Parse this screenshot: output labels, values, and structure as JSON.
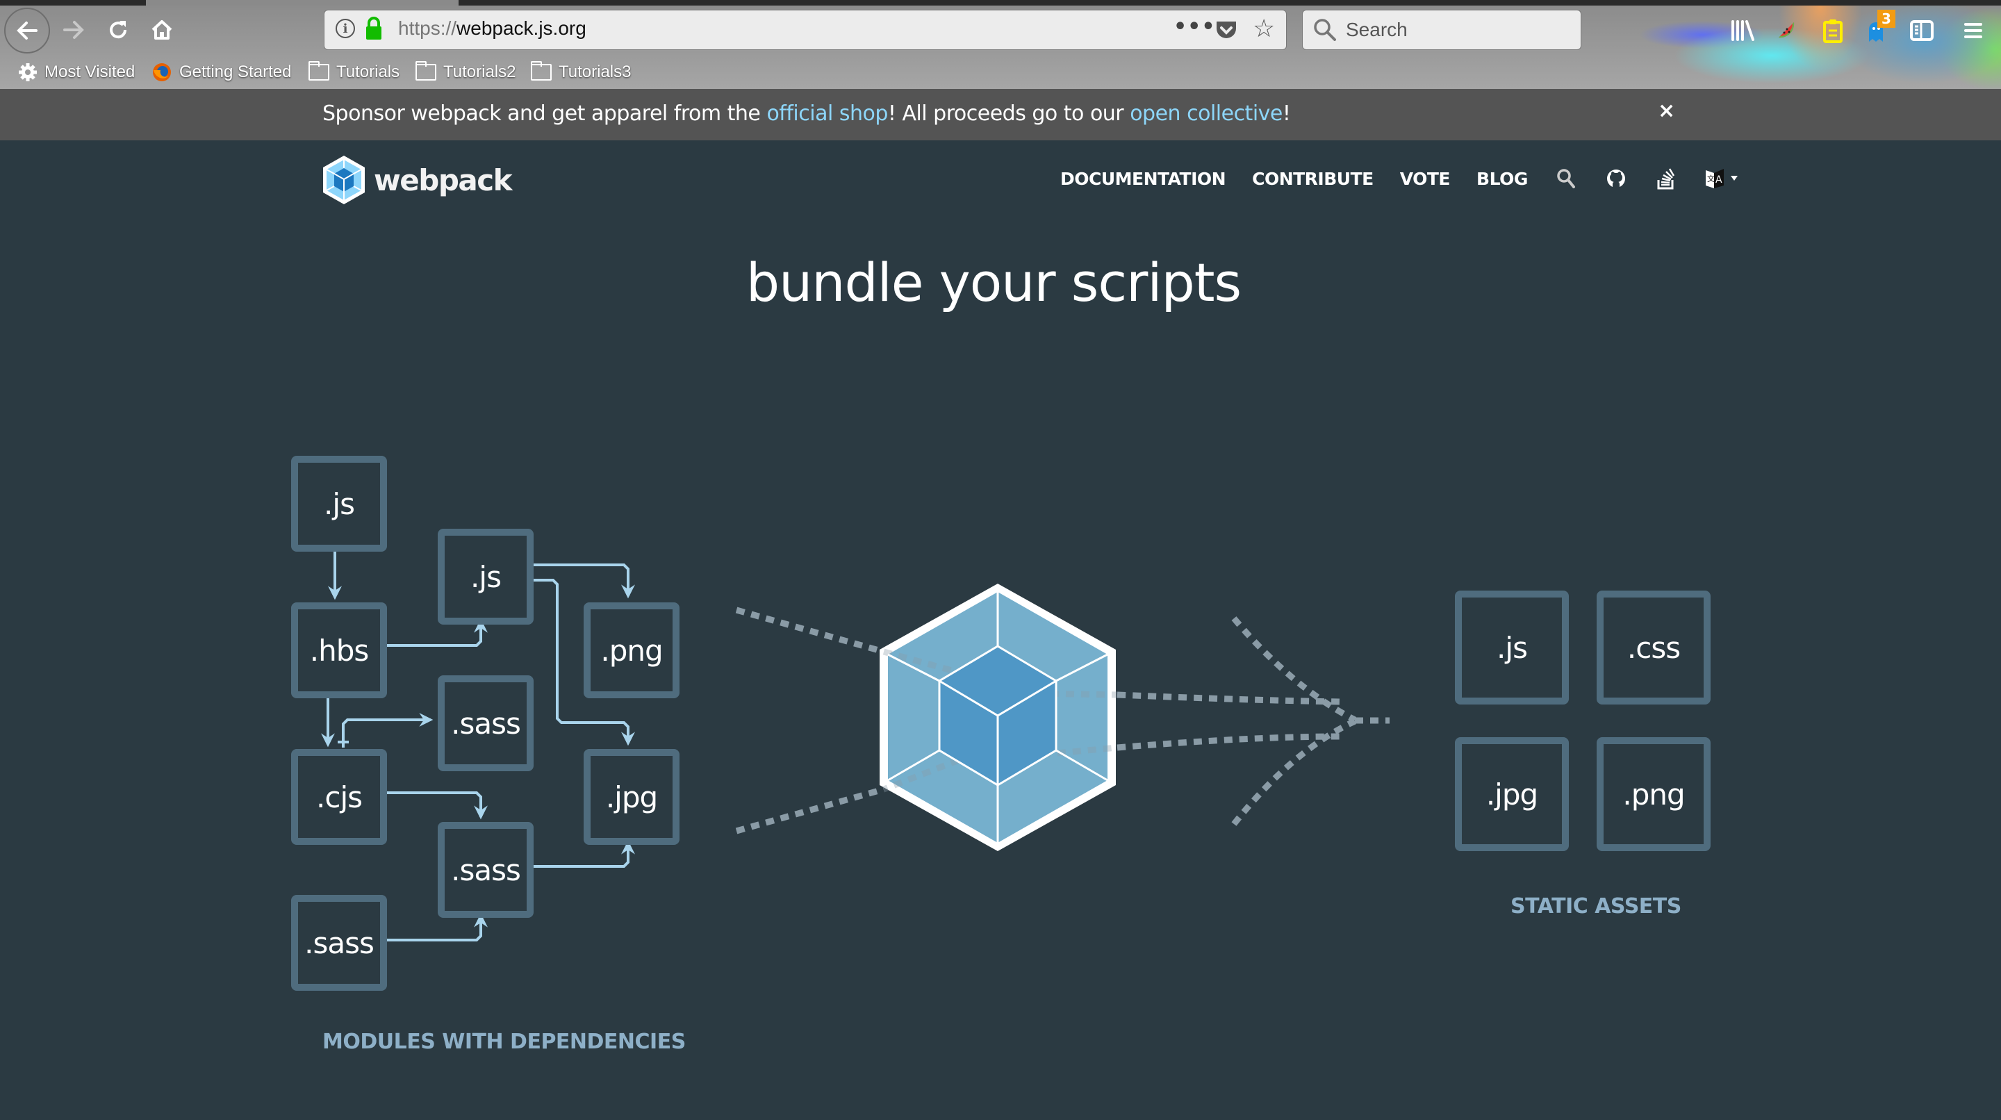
{
  "browser": {
    "url_scheme": "https://",
    "url_host": "webpack.js.org",
    "search_placeholder": "Search",
    "notification_badge": "3",
    "bookmarks": [
      {
        "label": "Most Visited",
        "icon": "gear-icon"
      },
      {
        "label": "Getting Started",
        "icon": "firefox-icon"
      },
      {
        "label": "Tutorials",
        "icon": "folder-icon"
      },
      {
        "label": "Tutorials2",
        "icon": "folder-icon"
      },
      {
        "label": "Tutorials3",
        "icon": "folder-icon"
      }
    ]
  },
  "banner": {
    "text_before": "Sponsor webpack and get apparel from the ",
    "link1": "official shop",
    "text_middle": "! All proceeds go to our ",
    "link2": "open collective",
    "text_after": "!",
    "close_label": "×"
  },
  "header": {
    "logo_text": "webpack",
    "nav": [
      "DOCUMENTATION",
      "CONTRIBUTE",
      "VOTE",
      "BLOG"
    ],
    "icons": [
      "search-icon",
      "github-icon",
      "stackoverflow-icon",
      "language-icon"
    ]
  },
  "hero": {
    "title": "bundle your scripts"
  },
  "diagram": {
    "modules": [
      ".js",
      ".js",
      ".hbs",
      ".png",
      ".sass",
      ".cjs",
      ".jpg",
      ".sass",
      ".sass"
    ],
    "modules_label": "MODULES WITH DEPENDENCIES",
    "assets": [
      ".js",
      ".css",
      ".jpg",
      ".png"
    ],
    "assets_label": "STATIC ASSETS"
  },
  "colors": {
    "background": "#2b3a42",
    "banner": "#545454",
    "link": "#8dd6f9",
    "box_border": "#4f6c7e",
    "arrow": "#a9d4ec",
    "label": "#8eb0c8"
  }
}
